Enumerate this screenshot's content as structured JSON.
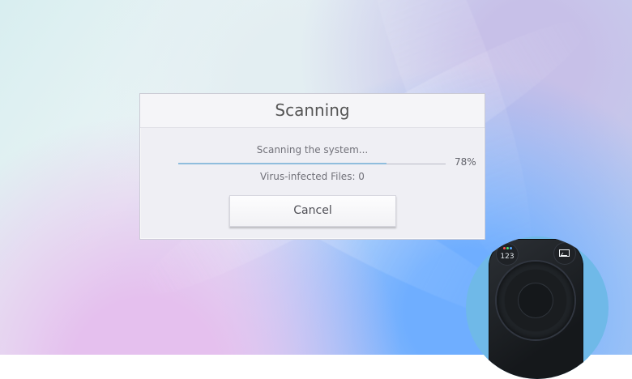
{
  "dialog": {
    "title": "Scanning",
    "status": "Scanning the system...",
    "progress_percent": "78%",
    "progress_value": 0.78,
    "infected_files": "Virus-infected Files: 0",
    "cancel_label": "Cancel"
  },
  "remote": {
    "number_button_label": "123",
    "icons": {
      "numbers": "number-button-icon",
      "ambient": "ambient-mode-icon",
      "dpad": "directional-pad-icon"
    }
  },
  "colors": {
    "dialog_background": "#efeff4",
    "progress_fill": "#8fbddd",
    "text": "#717179",
    "remote_circle": "#6fb9e8"
  }
}
